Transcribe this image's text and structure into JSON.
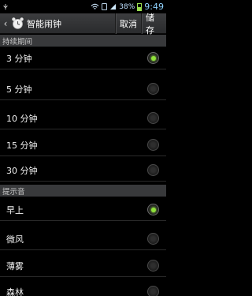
{
  "status_bar": {
    "icons": [
      "usb-icon",
      "signal-icon",
      "wifi-icon",
      "sim-icon"
    ],
    "battery_percent": "38%",
    "time": "9:49",
    "battery_level": 0.38
  },
  "action_bar": {
    "title": "智能闹钟",
    "cancel_label": "取消",
    "save_label": "储存"
  },
  "duration_section": {
    "header": "持续期间",
    "options": [
      {
        "label": "3 分钟",
        "selected": true
      },
      {
        "label": "5 分钟",
        "selected": false
      },
      {
        "label": "10 分钟",
        "selected": false
      },
      {
        "label": "15 分钟",
        "selected": false
      },
      {
        "label": "30 分钟",
        "selected": false
      }
    ]
  },
  "tone_section": {
    "header": "提示音",
    "options": [
      {
        "label": "早上",
        "selected": true
      },
      {
        "label": "微风",
        "selected": false
      },
      {
        "label": "薄雾",
        "selected": false
      },
      {
        "label": "森林",
        "selected": false
      }
    ]
  },
  "colors": {
    "selected_radio": "#8fe03a",
    "action_bar_bg": "#3c3d3f",
    "section_header_bg": "#38393b"
  }
}
